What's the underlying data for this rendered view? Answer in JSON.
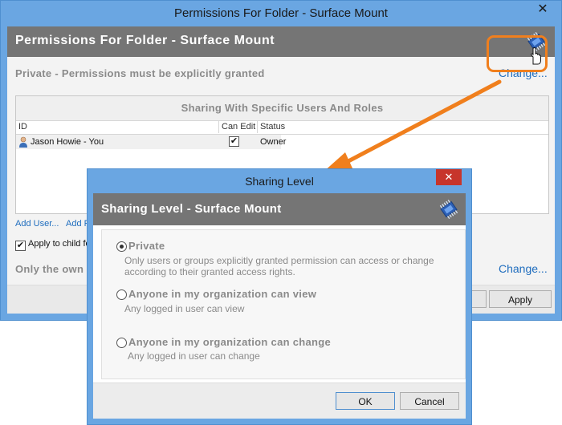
{
  "back_window": {
    "title": "Permissions For Folder - Surface Mount",
    "close_glyph": "✕",
    "banner_title": "Permissions For Folder - Surface Mount",
    "private_text": "Private - Permissions must be explicitly granted",
    "change_label": "Change...",
    "sharing_header": "Sharing With Specific Users And Roles",
    "columns": [
      "ID",
      "Can Edit",
      "Status"
    ],
    "rows": [
      {
        "id": "Jason Howie - You",
        "can_edit": "✔",
        "status": "Owner"
      }
    ],
    "add_user": "Add User...",
    "add_role": "Add R",
    "apply_child": "Apply to child fo",
    "only_owner": "Only the own",
    "change_bottom": "Change...",
    "apply_button": "Apply"
  },
  "dialog": {
    "title": "Sharing Level",
    "close_glyph": "✕",
    "banner_title": "Sharing Level - Surface Mount",
    "options": [
      {
        "label": "Private",
        "selected": true,
        "description": "Only users or groups explicitly granted permission can access or change according to their granted access rights."
      },
      {
        "label": "Anyone in my organization can view",
        "selected": false,
        "description": "Any logged in user can view"
      },
      {
        "label": "Anyone in my organization can change",
        "selected": false,
        "description": "Any logged in user can change"
      }
    ],
    "ok_label": "OK",
    "cancel_label": "Cancel"
  },
  "colors": {
    "window_frame": "#6aa6e2",
    "banner": "#757575",
    "highlight": "#f07f1d",
    "link": "#1f6dbe",
    "close_red": "#c7352b"
  },
  "icons": [
    "chip-icon",
    "user-icon",
    "hand-cursor-icon",
    "radio-icon",
    "checkbox-icon",
    "arrow-annotation"
  ]
}
